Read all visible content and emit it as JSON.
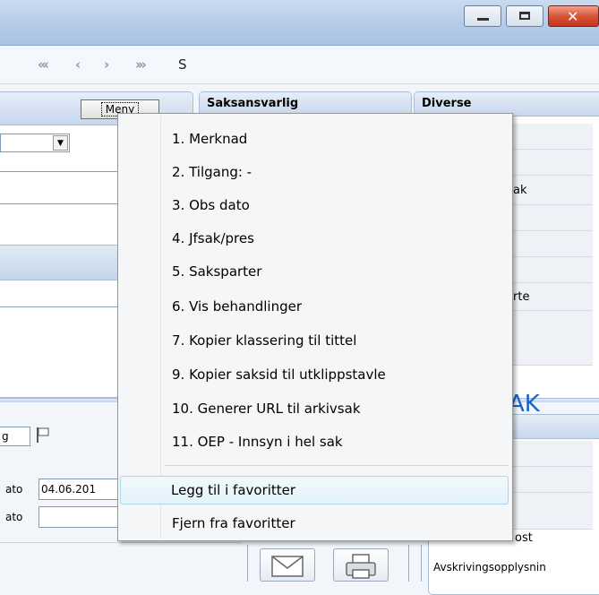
{
  "toolbar": {
    "s_label": "S"
  },
  "left_panel": {
    "meny_button": "Meny"
  },
  "saksansvarlig": {
    "title": "Saksansvarlig"
  },
  "diverse": {
    "title": "Diverse",
    "partial_items": [
      "ak",
      "rte"
    ]
  },
  "form": {
    "dato_label_1": "ato",
    "dato_value_1": "04.06.201",
    "dato_label_2": "ato",
    "left_value": "g"
  },
  "heading_fragment": "AK",
  "right_bottom": {
    "ost": "ost",
    "avskriving": "Avskrivingsopplysnin"
  },
  "menu": {
    "items": [
      "1. Merknad",
      "2. Tilgang: -",
      "3. Obs dato",
      "4. Jfsak/pres",
      "5. Saksparter",
      "6. Vis behandlinger",
      "7. Kopier klassering til tittel",
      "9. Kopier saksid til utklippstavle",
      "10. Generer URL til arkivsak",
      "11. OEP - Innsyn i hel sak"
    ],
    "favorites": [
      "Legg til i favoritter",
      "Fjern fra favoritter"
    ]
  },
  "icons": [
    "minimize-icon",
    "maximize-icon",
    "close-icon",
    "first-icon",
    "prev-icon",
    "next-icon",
    "last-icon",
    "flag-icon",
    "envelope-icon",
    "printer-icon"
  ]
}
